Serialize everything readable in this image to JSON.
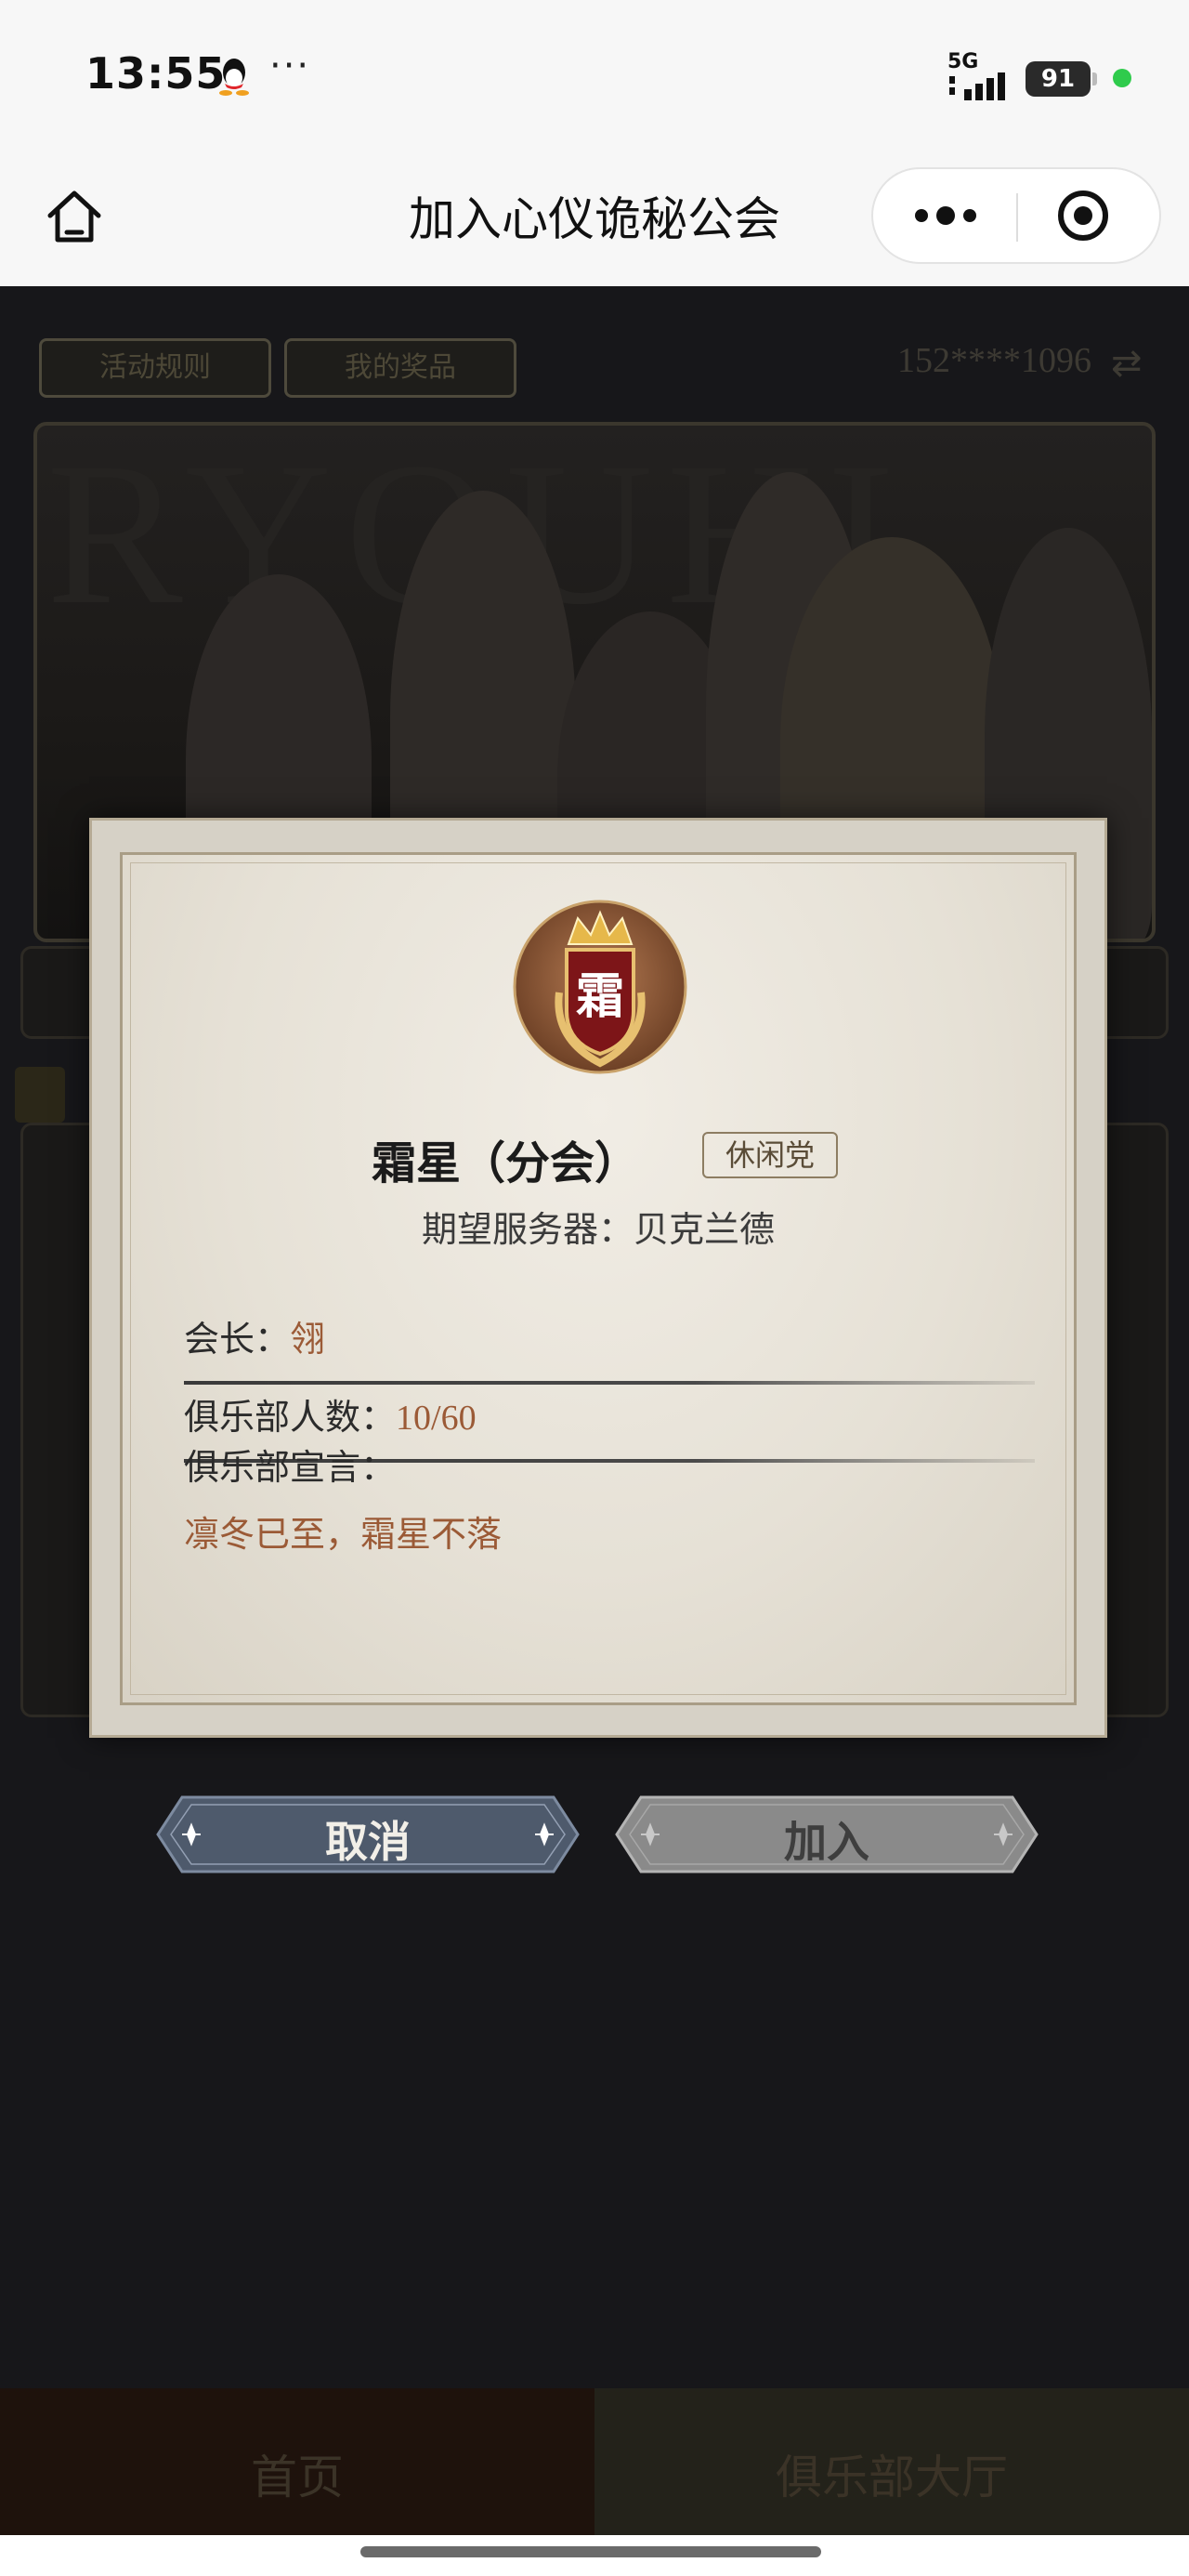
{
  "status_bar": {
    "time": "13:55",
    "more": "···",
    "network": "5G",
    "battery": "91"
  },
  "nav": {
    "title": "加入心仪诡秘公会"
  },
  "background_page": {
    "rules_label": "活动规则",
    "prizes_label": "我的奖品",
    "phone": "152****1096",
    "tabs": [
      "首页",
      "俱乐部大厅"
    ]
  },
  "modal": {
    "emblem_char": "霜",
    "club_name": "霜星（分会）",
    "club_tag": "休闲党",
    "server_line": "期望服务器：贝克兰德",
    "president_label": "会长：",
    "president_value": "翎",
    "members_label": "俱乐部人数：",
    "members_value": "10/60",
    "motto_label": "俱乐部宣言：",
    "motto_text": "凛冬已至，霜星不落"
  },
  "buttons": {
    "cancel": "取消",
    "join": "加入"
  },
  "colors": {
    "accent_text": "#9b5a36",
    "cancel_button": "#4e5a6c",
    "join_button": "#8a8a8a",
    "status_dot": "#2fcb4c"
  }
}
